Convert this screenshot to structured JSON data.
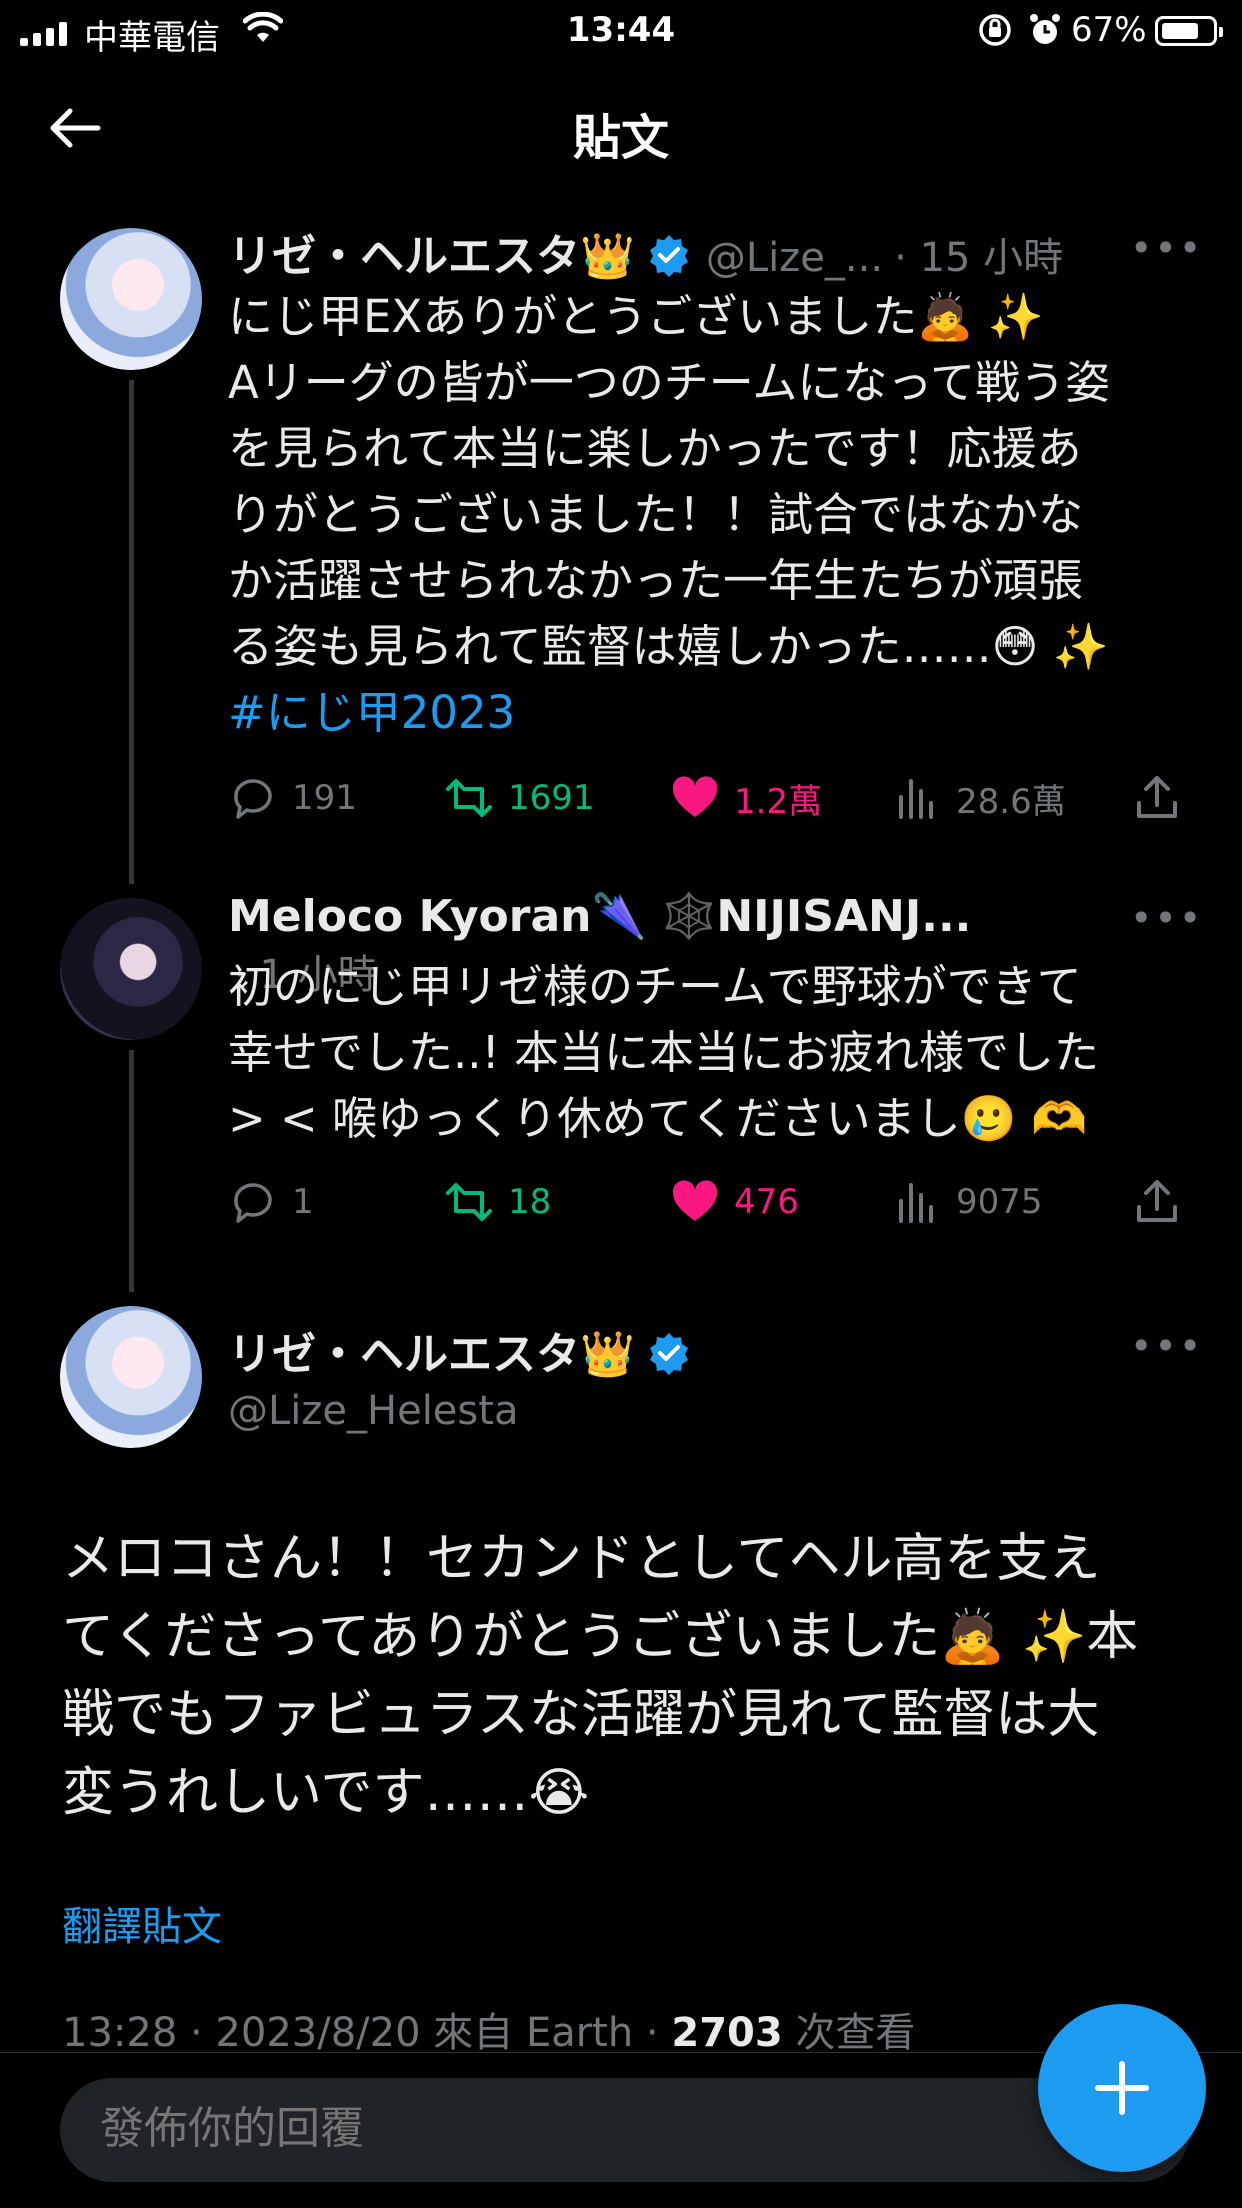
{
  "status": {
    "carrier": "中華電信",
    "time": "13:44",
    "battery": "67%"
  },
  "nav": {
    "title": "貼文"
  },
  "thread": [
    {
      "name": "リゼ・ヘルエスタ👑",
      "handle": "@Lize_...",
      "time": "· 15 小時",
      "lines": [
        "にじ甲EXありがとうございました🙇 ✨",
        "Aリーグの皆が一つのチームになって戦う姿",
        "を見られて本当に楽しかったです！応援あ",
        "りがとうございました！！試合ではなかな",
        "か活躍させられなかった一年生たちが頑張",
        "る姿も見られて監督は嬉しかった……😳 ✨"
      ],
      "hashtag": "#にじ甲2023",
      "replies": "191",
      "retweets": "1691",
      "likes": "1.2萬",
      "views": "28.6萬"
    },
    {
      "name": "Meloco Kyoran🌂 🕸️NIJISANJ...",
      "time": "· 1 小時",
      "lines": [
        "初のにじ甲リゼ様のチームで野球ができて",
        "幸せでした..! 本当に本当にお疲れ様でした",
        "> < 喉ゆっくり休めてくださいまし🥲 🫶"
      ],
      "replies": "1",
      "retweets": "18",
      "likes": "476",
      "views": "9075"
    }
  ],
  "main": {
    "name": "リゼ・ヘルエスタ👑",
    "handle": "@Lize_Helesta",
    "lines": [
      "メロコさん！！セカンドとしてヘル高を支え",
      "てくださってありがとうございました🙇 ✨本",
      "戦でもファビュラスな活躍が見れて監督は大",
      "変うれしいです……😭"
    ],
    "translate": "翻譯貼文",
    "timestamp": "13:28 · 2023/8/20 來自 Earth · ",
    "views_count": "2703",
    "views_label": " 次查看"
  },
  "reply": {
    "placeholder": "發佈你的回覆"
  },
  "colors": {
    "accent": "#1d9bf0",
    "like": "#f91880",
    "retweet": "#00ba7c",
    "muted": "#71767b"
  }
}
